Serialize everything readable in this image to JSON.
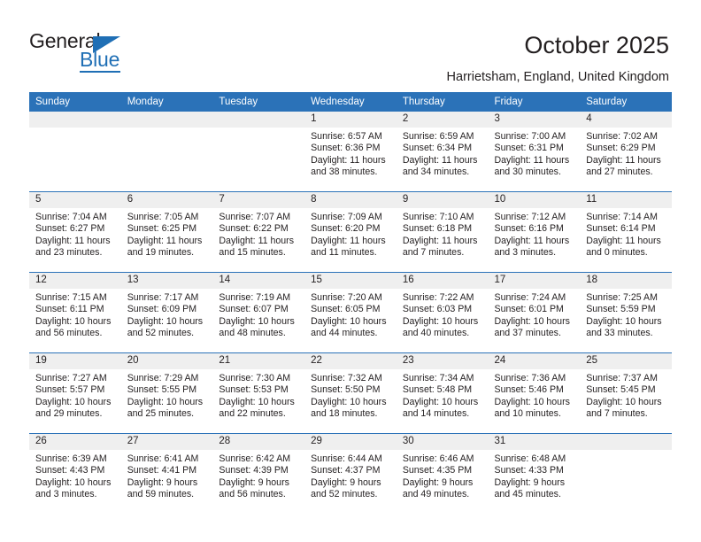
{
  "logo": {
    "word_one": "General",
    "word_two": "Blue",
    "triangle_icon": "triangle-icon"
  },
  "header": {
    "title": "October 2025",
    "location": "Harrietsham, England, United Kingdom"
  },
  "colors": {
    "header_blue": "#2b72b8",
    "logo_blue": "#1f6fb5",
    "daynum_band": "#efefef",
    "text": "#231f20"
  },
  "calendar": {
    "weekday_headers": [
      "Sunday",
      "Monday",
      "Tuesday",
      "Wednesday",
      "Thursday",
      "Friday",
      "Saturday"
    ],
    "weeks": [
      [
        {
          "day": "",
          "lines": []
        },
        {
          "day": "",
          "lines": []
        },
        {
          "day": "",
          "lines": []
        },
        {
          "day": "1",
          "lines": [
            "Sunrise: 6:57 AM",
            "Sunset: 6:36 PM",
            "Daylight: 11 hours",
            "and 38 minutes."
          ]
        },
        {
          "day": "2",
          "lines": [
            "Sunrise: 6:59 AM",
            "Sunset: 6:34 PM",
            "Daylight: 11 hours",
            "and 34 minutes."
          ]
        },
        {
          "day": "3",
          "lines": [
            "Sunrise: 7:00 AM",
            "Sunset: 6:31 PM",
            "Daylight: 11 hours",
            "and 30 minutes."
          ]
        },
        {
          "day": "4",
          "lines": [
            "Sunrise: 7:02 AM",
            "Sunset: 6:29 PM",
            "Daylight: 11 hours",
            "and 27 minutes."
          ]
        }
      ],
      [
        {
          "day": "5",
          "lines": [
            "Sunrise: 7:04 AM",
            "Sunset: 6:27 PM",
            "Daylight: 11 hours",
            "and 23 minutes."
          ]
        },
        {
          "day": "6",
          "lines": [
            "Sunrise: 7:05 AM",
            "Sunset: 6:25 PM",
            "Daylight: 11 hours",
            "and 19 minutes."
          ]
        },
        {
          "day": "7",
          "lines": [
            "Sunrise: 7:07 AM",
            "Sunset: 6:22 PM",
            "Daylight: 11 hours",
            "and 15 minutes."
          ]
        },
        {
          "day": "8",
          "lines": [
            "Sunrise: 7:09 AM",
            "Sunset: 6:20 PM",
            "Daylight: 11 hours",
            "and 11 minutes."
          ]
        },
        {
          "day": "9",
          "lines": [
            "Sunrise: 7:10 AM",
            "Sunset: 6:18 PM",
            "Daylight: 11 hours",
            "and 7 minutes."
          ]
        },
        {
          "day": "10",
          "lines": [
            "Sunrise: 7:12 AM",
            "Sunset: 6:16 PM",
            "Daylight: 11 hours",
            "and 3 minutes."
          ]
        },
        {
          "day": "11",
          "lines": [
            "Sunrise: 7:14 AM",
            "Sunset: 6:14 PM",
            "Daylight: 11 hours",
            "and 0 minutes."
          ]
        }
      ],
      [
        {
          "day": "12",
          "lines": [
            "Sunrise: 7:15 AM",
            "Sunset: 6:11 PM",
            "Daylight: 10 hours",
            "and 56 minutes."
          ]
        },
        {
          "day": "13",
          "lines": [
            "Sunrise: 7:17 AM",
            "Sunset: 6:09 PM",
            "Daylight: 10 hours",
            "and 52 minutes."
          ]
        },
        {
          "day": "14",
          "lines": [
            "Sunrise: 7:19 AM",
            "Sunset: 6:07 PM",
            "Daylight: 10 hours",
            "and 48 minutes."
          ]
        },
        {
          "day": "15",
          "lines": [
            "Sunrise: 7:20 AM",
            "Sunset: 6:05 PM",
            "Daylight: 10 hours",
            "and 44 minutes."
          ]
        },
        {
          "day": "16",
          "lines": [
            "Sunrise: 7:22 AM",
            "Sunset: 6:03 PM",
            "Daylight: 10 hours",
            "and 40 minutes."
          ]
        },
        {
          "day": "17",
          "lines": [
            "Sunrise: 7:24 AM",
            "Sunset: 6:01 PM",
            "Daylight: 10 hours",
            "and 37 minutes."
          ]
        },
        {
          "day": "18",
          "lines": [
            "Sunrise: 7:25 AM",
            "Sunset: 5:59 PM",
            "Daylight: 10 hours",
            "and 33 minutes."
          ]
        }
      ],
      [
        {
          "day": "19",
          "lines": [
            "Sunrise: 7:27 AM",
            "Sunset: 5:57 PM",
            "Daylight: 10 hours",
            "and 29 minutes."
          ]
        },
        {
          "day": "20",
          "lines": [
            "Sunrise: 7:29 AM",
            "Sunset: 5:55 PM",
            "Daylight: 10 hours",
            "and 25 minutes."
          ]
        },
        {
          "day": "21",
          "lines": [
            "Sunrise: 7:30 AM",
            "Sunset: 5:53 PM",
            "Daylight: 10 hours",
            "and 22 minutes."
          ]
        },
        {
          "day": "22",
          "lines": [
            "Sunrise: 7:32 AM",
            "Sunset: 5:50 PM",
            "Daylight: 10 hours",
            "and 18 minutes."
          ]
        },
        {
          "day": "23",
          "lines": [
            "Sunrise: 7:34 AM",
            "Sunset: 5:48 PM",
            "Daylight: 10 hours",
            "and 14 minutes."
          ]
        },
        {
          "day": "24",
          "lines": [
            "Sunrise: 7:36 AM",
            "Sunset: 5:46 PM",
            "Daylight: 10 hours",
            "and 10 minutes."
          ]
        },
        {
          "day": "25",
          "lines": [
            "Sunrise: 7:37 AM",
            "Sunset: 5:45 PM",
            "Daylight: 10 hours",
            "and 7 minutes."
          ]
        }
      ],
      [
        {
          "day": "26",
          "lines": [
            "Sunrise: 6:39 AM",
            "Sunset: 4:43 PM",
            "Daylight: 10 hours",
            "and 3 minutes."
          ]
        },
        {
          "day": "27",
          "lines": [
            "Sunrise: 6:41 AM",
            "Sunset: 4:41 PM",
            "Daylight: 9 hours",
            "and 59 minutes."
          ]
        },
        {
          "day": "28",
          "lines": [
            "Sunrise: 6:42 AM",
            "Sunset: 4:39 PM",
            "Daylight: 9 hours",
            "and 56 minutes."
          ]
        },
        {
          "day": "29",
          "lines": [
            "Sunrise: 6:44 AM",
            "Sunset: 4:37 PM",
            "Daylight: 9 hours",
            "and 52 minutes."
          ]
        },
        {
          "day": "30",
          "lines": [
            "Sunrise: 6:46 AM",
            "Sunset: 4:35 PM",
            "Daylight: 9 hours",
            "and 49 minutes."
          ]
        },
        {
          "day": "31",
          "lines": [
            "Sunrise: 6:48 AM",
            "Sunset: 4:33 PM",
            "Daylight: 9 hours",
            "and 45 minutes."
          ]
        },
        {
          "day": "",
          "lines": []
        }
      ]
    ]
  }
}
